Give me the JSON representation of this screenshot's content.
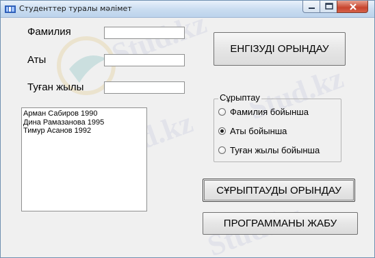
{
  "window": {
    "title": "Студенттер туралы мәлімет",
    "icon": "app-icon"
  },
  "titlebar_buttons": [
    "minimize-icon",
    "maximize-icon",
    "close-icon"
  ],
  "form": {
    "surname_label": "Фамилия",
    "name_label": "Аты",
    "birth_year_label": "Туған жылы",
    "surname_value": "",
    "name_value": "",
    "birth_year_value": ""
  },
  "list": {
    "items": [
      "Арман Сабиров 1990",
      "Дина Рамазанова 1995",
      "Тимур Асанов 1992"
    ]
  },
  "buttons": {
    "enter": "ЕНГІЗУДІ ОРЫНДАУ",
    "sort": "СҰРЫПТАУДЫ  ОРЫНДАУ",
    "close": "ПРОГРАММАНЫ ЖАБУ"
  },
  "sort_group": {
    "title": "Сұрыптау",
    "options": [
      "Фамилия бойынша",
      "Аты бойынша",
      "Туған жылы бойынша"
    ],
    "selected": "Аты бойынша"
  },
  "watermark": "Stud.kz"
}
